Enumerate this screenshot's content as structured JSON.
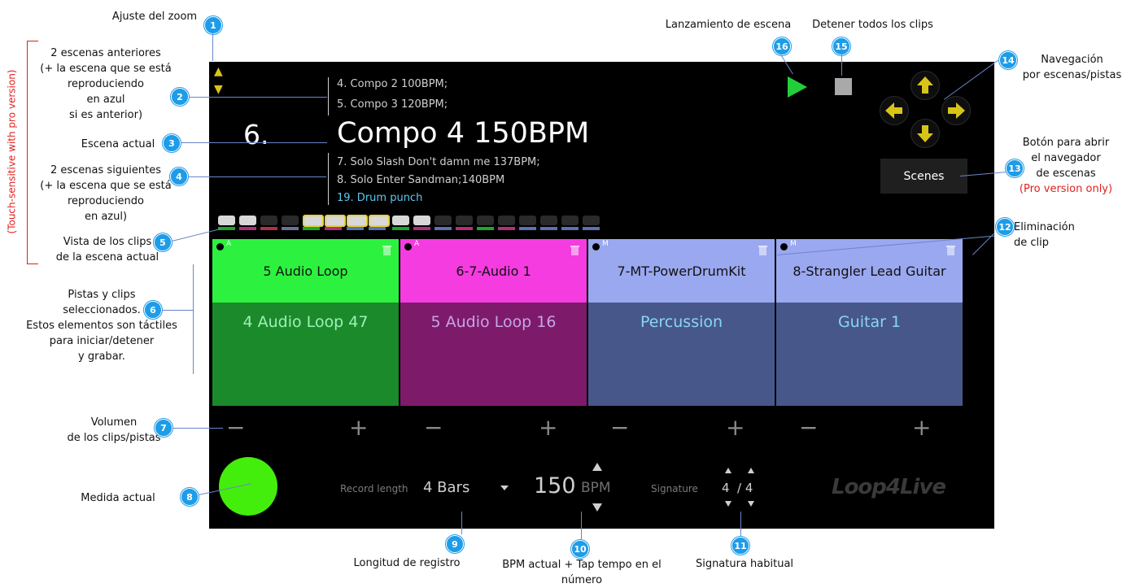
{
  "app": {
    "zoom_up": "▲",
    "zoom_down": "▼",
    "prev_scenes": [
      "4. Compo 2 100BPM;",
      "5. Compo 3 120BPM;"
    ],
    "current_number": "6.",
    "current_name": "Compo 4 150BPM",
    "next_scenes": [
      "7. Solo Slash Don't damn me 137BPM;",
      "8. Solo Enter Sandman;140BPM"
    ],
    "playing_scene": "19. Drum punch",
    "scenes_button": "Scenes",
    "tracks": [
      {
        "tag": "A",
        "clip": "5 Audio Loop",
        "track": "4 Audio Loop 47",
        "top_color": "#2cf23f",
        "bottom_color": "#1b8a2b",
        "text_color": "#9ef0b6"
      },
      {
        "tag": "A",
        "clip": "6-7-Audio 1",
        "track": "5 Audio Loop 16",
        "top_color": "#f43ce0",
        "bottom_color": "#7e1a6a",
        "text_color": "#c7a4e6"
      },
      {
        "tag": "M",
        "clip": "7-MT-PowerDrumKit",
        "track": "Percussion",
        "top_color": "#9aa8f0",
        "bottom_color": "#48578a",
        "text_color": "#88d6f2"
      },
      {
        "tag": "M",
        "clip": "8-Strangler Lead Guitar",
        "track": "Guitar 1",
        "top_color": "#9aa8f0",
        "bottom_color": "#48578a",
        "text_color": "#88d6f2"
      }
    ],
    "volume_minus": "−",
    "volume_plus": "+",
    "record_length_label": "Record length",
    "record_length_value": "4 Bars",
    "bpm_value": "150",
    "bpm_label": "BPM",
    "signature_label": "Signature",
    "signature_num": "4",
    "signature_den": "/ 4",
    "logo": "Loop4Live",
    "colors": {
      "scene_playing": "#5ec8f0",
      "play_green": "#22cf3a",
      "nav_yellow": "#d8c418",
      "measure_green": "#44ee0c"
    }
  },
  "annotations": {
    "n1": {
      "num": "1",
      "text": "Ajuste del zoom"
    },
    "n2": {
      "num": "2",
      "l1": "2 escenas anteriores",
      "l2": "(+ la escena que se está",
      "l3": "reproduciendo",
      "l4": "en azul",
      "l5": "si es anterior)"
    },
    "n3": {
      "num": "3",
      "text": "Escena actual"
    },
    "n4": {
      "num": "4",
      "l1": "2 escenas siguientes",
      "l2": "(+ la escena que se está",
      "l3": "reproduciendo",
      "l4": "en azul)"
    },
    "n5": {
      "num": "5",
      "l1": "Vista de los clips",
      "l2": "de la escena actual"
    },
    "n6": {
      "num": "6",
      "l1": "Pistas y clips",
      "l2": "seleccionados.",
      "l3": "Estos elementos son táctiles",
      "l4": "para iniciar/detener",
      "l5": "y grabar."
    },
    "n7": {
      "num": "7",
      "l1": "Volumen",
      "l2": "de los clips/pistas"
    },
    "n8": {
      "num": "8",
      "text": "Medida actual"
    },
    "n9": {
      "num": "9",
      "text": "Longitud de registro"
    },
    "n10": {
      "num": "10",
      "l1": "BPM actual + Tap tempo en el",
      "l2": "número"
    },
    "n11": {
      "num": "11",
      "text": "Signatura habitual"
    },
    "n12": {
      "num": "12",
      "l1": "Eliminación",
      "l2": "de clip"
    },
    "n13": {
      "num": "13",
      "l1": "Botón para abrir",
      "l2": "el navegador",
      "l3": "de escenas",
      "l4": "(Pro version only)"
    },
    "n14": {
      "num": "14",
      "l1": "Navegación",
      "l2": "por escenas/pistas"
    },
    "n15": {
      "num": "15",
      "text": "Detener todos los clips"
    },
    "n16": {
      "num": "16",
      "text": "Lanzamiento de escena"
    },
    "side_note": "(Touch-sensitive with pro version)"
  }
}
